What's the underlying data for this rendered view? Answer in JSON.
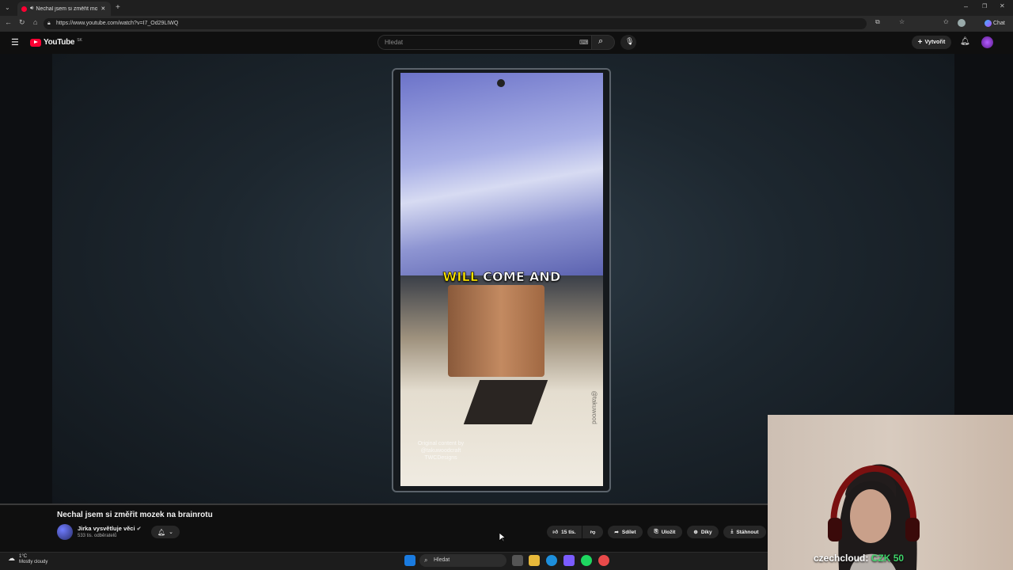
{
  "browser": {
    "tab_title": "Nechal jsem si změřit mozek",
    "url": "https://www.youtube.com/watch?v=I7_Od29LIWQ",
    "copilot_label": "Chat"
  },
  "youtube": {
    "logo_text": "YouTube",
    "country_code": "SK",
    "search_placeholder": "Hledat",
    "create_label": "Vytvořit"
  },
  "video": {
    "caption_yellow": "WILL",
    "caption_white": "COME AND",
    "watermark_lines": [
      "Original content by",
      "@takuwoodcraft",
      "TWCDesigns"
    ],
    "side_watermark": "@takuwood",
    "title": "Nechal jsem si změřit mozek na brainrotu",
    "channel_name": "Jirka vysvětluje věci",
    "subscribers": "533 tis. odběratelů",
    "like_count": "15 tis.",
    "share_label": "Sdílet",
    "save_label": "Uložit",
    "thanks_label": "Díky",
    "download_label": "Stáhnout"
  },
  "stream_overlay": {
    "donor": "czechcloud:",
    "amount": "CZK 50"
  },
  "taskbar": {
    "temperature": "1°C",
    "weather": "Mostly cloudy",
    "search_label": "Hledat"
  }
}
